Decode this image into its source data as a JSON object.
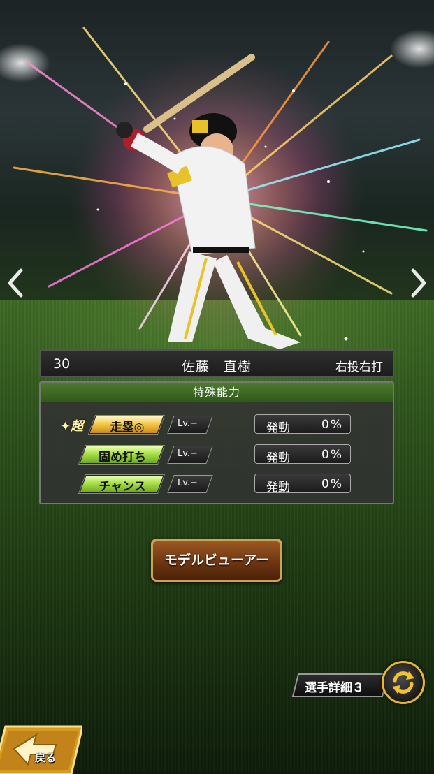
{
  "player": {
    "number": "30",
    "name": "佐藤　直樹",
    "handedness": "右投右打"
  },
  "abilities": {
    "header": "特殊能力",
    "activate_label": "発動",
    "items": [
      {
        "prefix": "超",
        "name": "走塁◎",
        "level": "Lv.−",
        "rate": "0%",
        "rank": "gold"
      },
      {
        "prefix": "",
        "name": "固め打ち",
        "level": "Lv.−",
        "rate": "0%",
        "rank": "green"
      },
      {
        "prefix": "",
        "name": "チャンス",
        "level": "Lv.−",
        "rate": "0%",
        "rank": "green"
      }
    ]
  },
  "buttons": {
    "model_viewer": "モデルビューアー",
    "player_detail": "選手詳細３",
    "back": "戻る"
  },
  "icons": {
    "prev": "chevron-left-icon",
    "next": "chevron-right-icon",
    "refresh": "refresh-icon",
    "back": "back-arrow-icon",
    "super": "sparkle-icon"
  },
  "colors": {
    "gold_tag": "#f5c84a",
    "green_tag": "#a8e046",
    "panel_header": "#3f6b24",
    "button_brown": "#6e3612",
    "accent_gold": "#e7b62a"
  }
}
